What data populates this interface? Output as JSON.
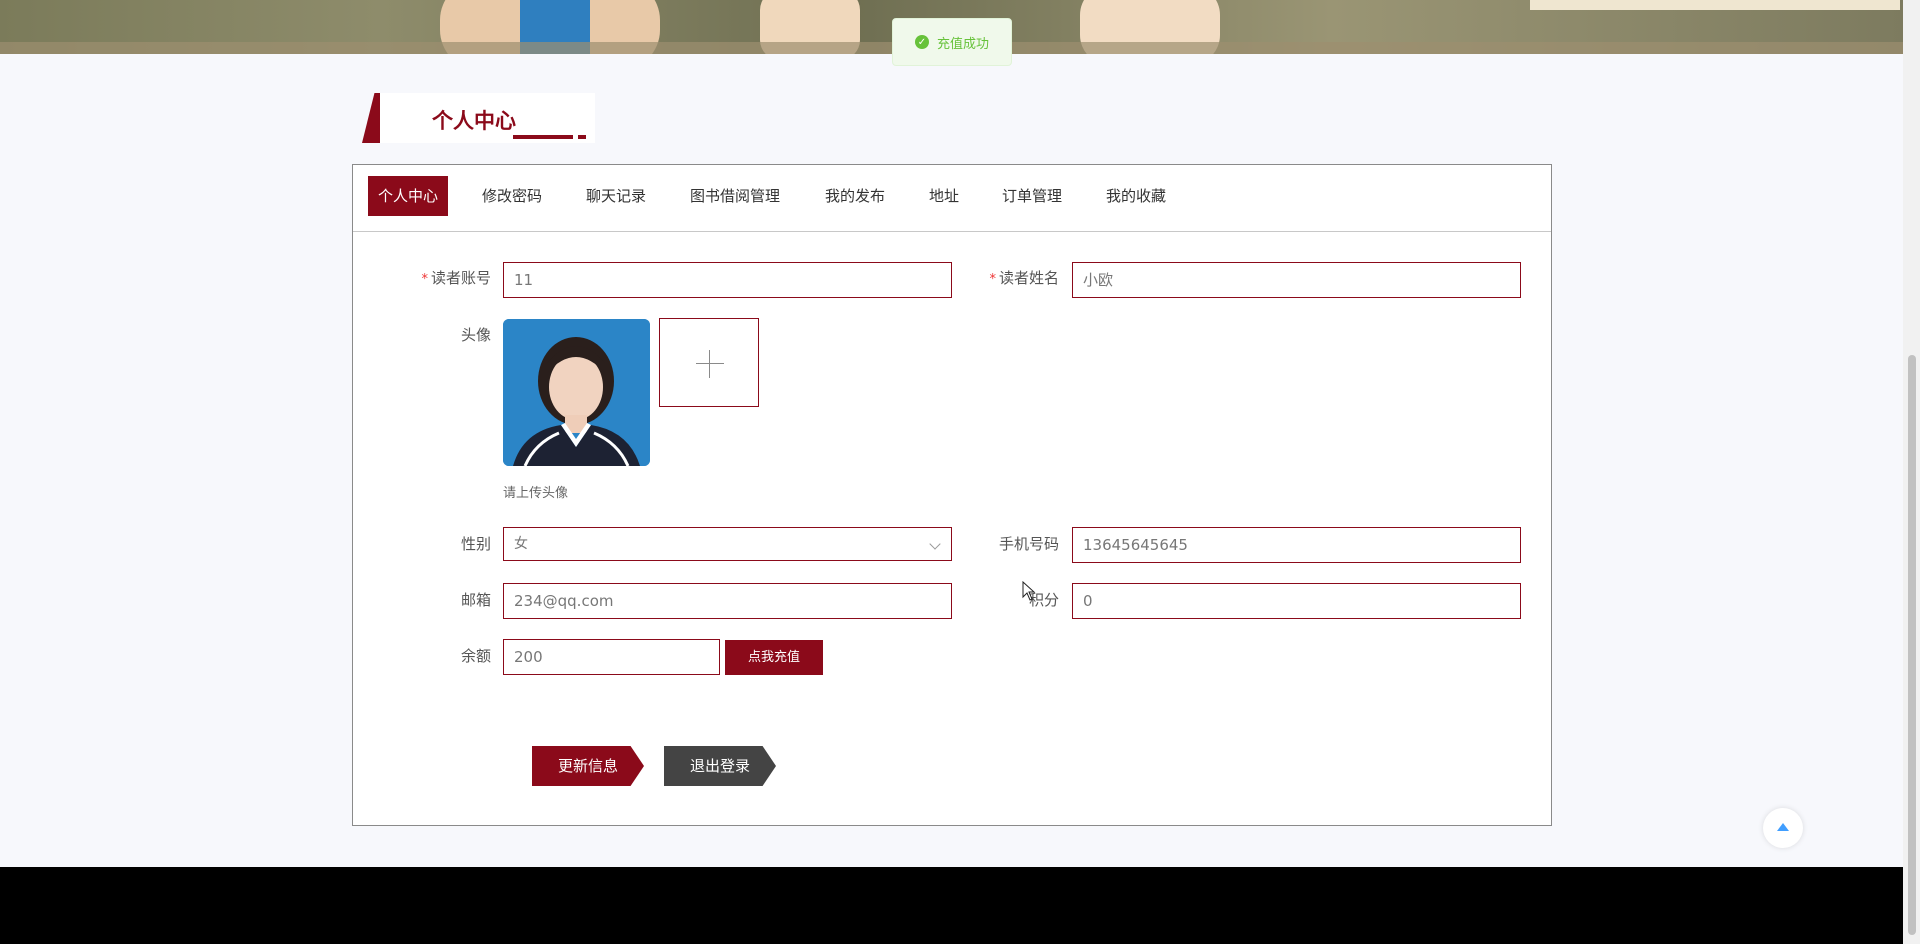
{
  "toast": {
    "message": "充值成功",
    "status_color": "#67c23a"
  },
  "section": {
    "title": "个人中心"
  },
  "tabs": [
    {
      "label": "个人中心",
      "active": true
    },
    {
      "label": "修改密码"
    },
    {
      "label": "聊天记录"
    },
    {
      "label": "图书借阅管理"
    },
    {
      "label": "我的发布"
    },
    {
      "label": "地址"
    },
    {
      "label": "订单管理"
    },
    {
      "label": "我的收藏"
    }
  ],
  "form": {
    "account": {
      "label": "读者账号",
      "required_mark": "*",
      "value": "11"
    },
    "name": {
      "label": "读者姓名",
      "required_mark": "*",
      "value": "小欧"
    },
    "avatar": {
      "label": "头像",
      "hint": "请上传头像"
    },
    "gender": {
      "label": "性别",
      "value": "女"
    },
    "phone": {
      "label": "手机号码",
      "value": "13645645645"
    },
    "email": {
      "label": "邮箱",
      "value": "234@qq.com"
    },
    "points": {
      "label": "积分",
      "value": "0"
    },
    "balance": {
      "label": "余额",
      "value": "200",
      "recharge_label": "点我充值"
    }
  },
  "actions": {
    "update_label": "更新信息",
    "logout_label": "退出登录"
  },
  "colors": {
    "accent": "#8b0a1a",
    "dark_button": "#444444",
    "footer": "#000000"
  },
  "icons": {
    "toast": "check-circle-icon",
    "upload": "plus-icon",
    "gender_select": "chevron-down-icon",
    "back_to_top": "arrow-up-icon"
  }
}
